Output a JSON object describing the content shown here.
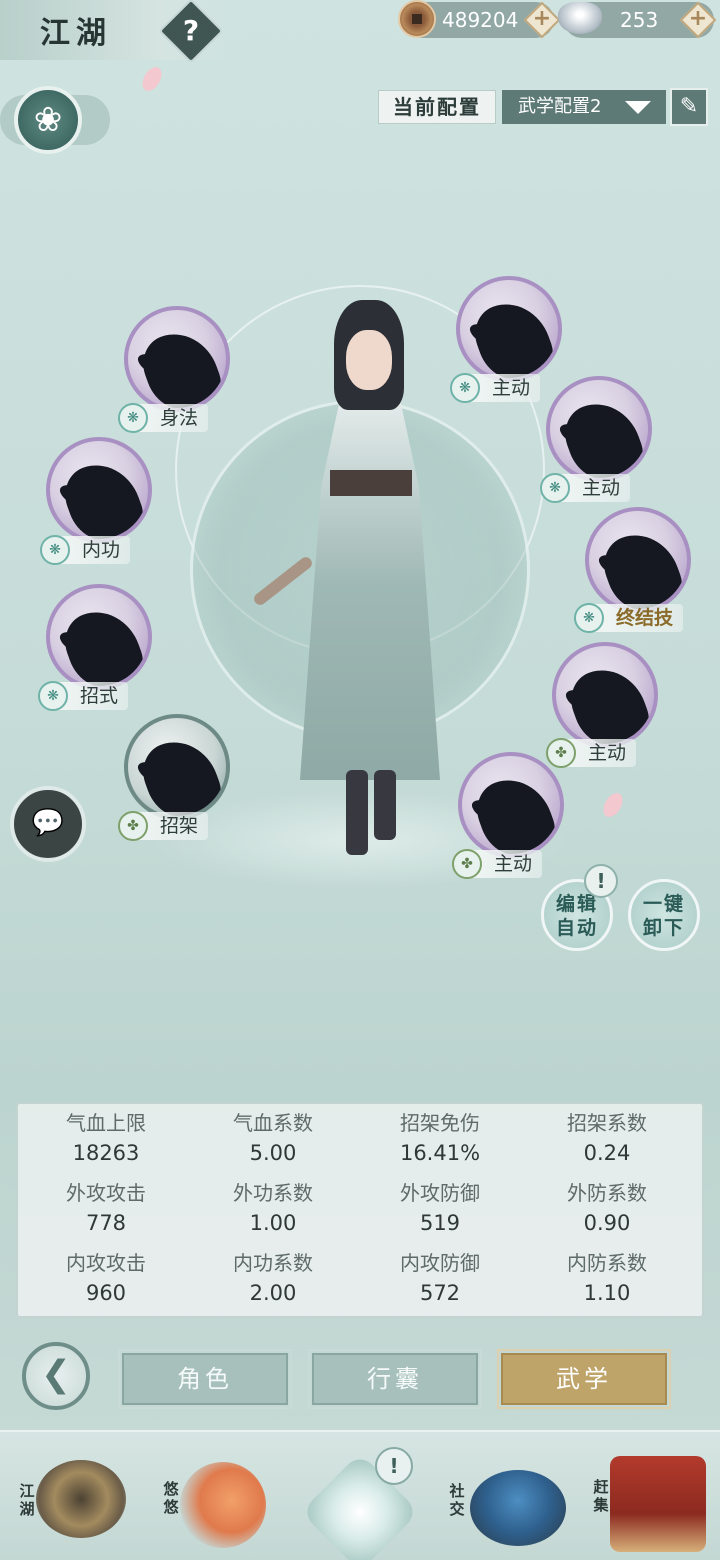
{
  "header": {
    "title": "江湖",
    "help": "?",
    "currency": [
      {
        "name": "copper-coin",
        "value": "489204"
      },
      {
        "name": "silver-ingot",
        "value": "253"
      }
    ],
    "plus": "+"
  },
  "config": {
    "label": "当前配置",
    "selected": "武学配置2"
  },
  "skills": {
    "left": [
      {
        "label": "身法"
      },
      {
        "label": "内功"
      },
      {
        "label": "招式"
      },
      {
        "label": "招架"
      }
    ],
    "right": [
      {
        "label": "主动"
      },
      {
        "label": "主动"
      },
      {
        "label": "终结技"
      },
      {
        "label": "主动"
      },
      {
        "label": "主动"
      }
    ]
  },
  "actions": {
    "auto_edit": "编辑自动",
    "unequip_all": "一键卸下",
    "alert": "!"
  },
  "stats": [
    {
      "label": "气血上限",
      "value": "18263"
    },
    {
      "label": "气血系数",
      "value": "5.00"
    },
    {
      "label": "招架免伤",
      "value": "16.41%"
    },
    {
      "label": "招架系数",
      "value": "0.24"
    },
    {
      "label": "外攻攻击",
      "value": "778"
    },
    {
      "label": "外功系数",
      "value": "1.00"
    },
    {
      "label": "外攻防御",
      "value": "519"
    },
    {
      "label": "外防系数",
      "value": "0.90"
    },
    {
      "label": "内攻攻击",
      "value": "960"
    },
    {
      "label": "内功系数",
      "value": "2.00"
    },
    {
      "label": "内攻防御",
      "value": "572"
    },
    {
      "label": "内防系数",
      "value": "1.10"
    }
  ],
  "tabs": [
    {
      "label": "角色",
      "active": false
    },
    {
      "label": "行囊",
      "active": false
    },
    {
      "label": "武学",
      "active": true
    }
  ],
  "bottom_nav": [
    {
      "label": "江湖"
    },
    {
      "label": "悠悠"
    },
    {
      "label": "社交"
    },
    {
      "label": "赶集"
    }
  ],
  "colors": {
    "accent_gold": "#bfa46a",
    "tab_inactive": "#a7c0bc",
    "skill_border": "#a890c2"
  }
}
